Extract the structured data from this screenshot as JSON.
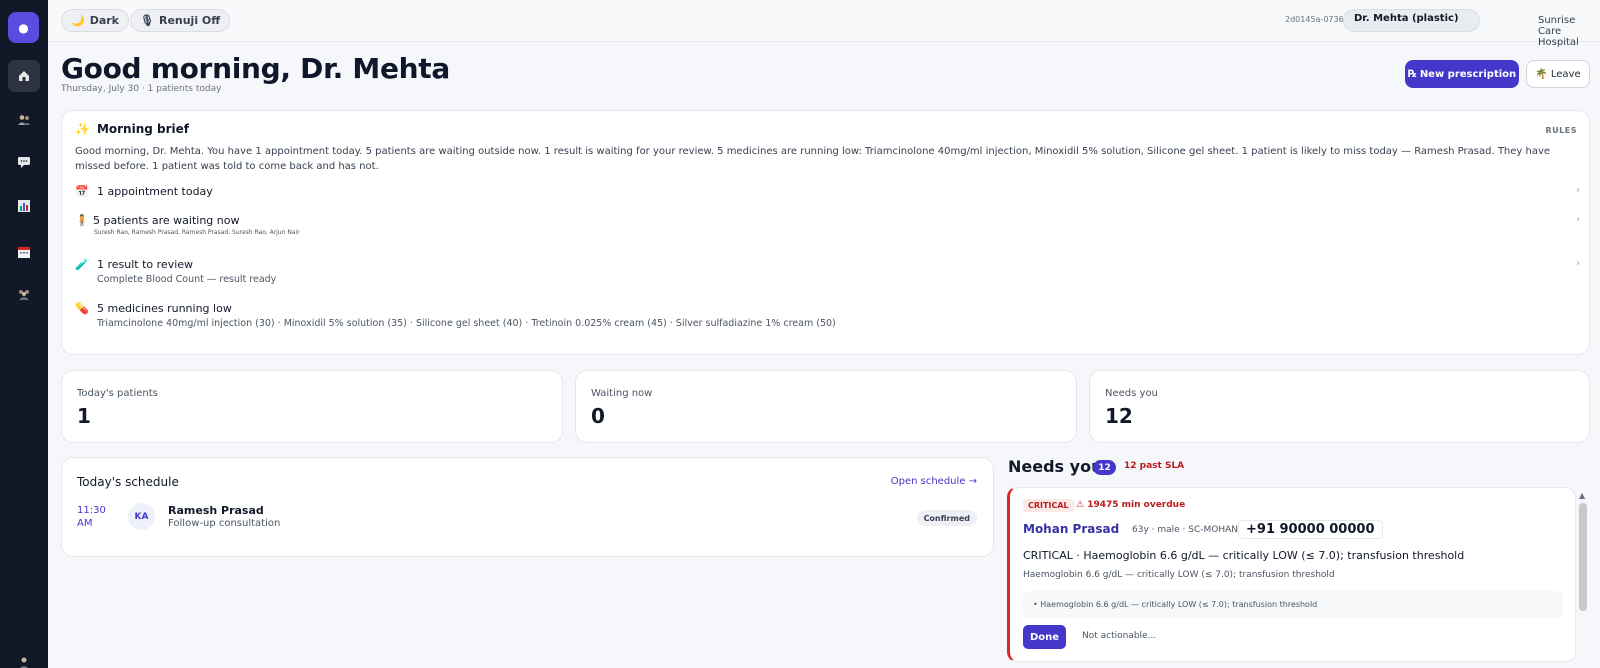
{
  "topbar": {
    "dark_label": "Dark",
    "renuji_label": "Renuji Off",
    "session_id": "2d0145a-0736",
    "user": "Dr. Mehta (plastic)",
    "hospital": "Sunrise Care Hospital"
  },
  "header": {
    "greeting": "Good morning, Dr. Mehta",
    "subdate": "Thursday, July 30 · 1 patients today",
    "new_rx_label": "New prescription",
    "leave_label": "Leave"
  },
  "brief": {
    "title": "Morning brief",
    "rules_label": "RULES",
    "text": "Good morning, Dr. Mehta.  You have 1 appointment today. 5 patients are waiting outside now. 1 result is waiting for your review. 5 medicines are running low: Triamcinolone 40mg/ml injection, Minoxidil 5% solution, Silicone gel sheet. 1 patient is likely to miss today — Ramesh Prasad. They have missed before. 1 patient was told to come back and has not.",
    "items": [
      {
        "label": "1 appointment today",
        "detail": ""
      },
      {
        "label": "5 patients are waiting now",
        "detail": "Suresh Rao, Ramesh Prasad, Ramesh Prasad, Suresh Rao, Arjun Nair"
      },
      {
        "label": "1 result to review",
        "detail": "Complete Blood Count — result ready"
      },
      {
        "label": "5 medicines running low",
        "detail": "Triamcinolone 40mg/ml injection (30) · Minoxidil 5% solution (35) · Silicone gel sheet (40) · Tretinoin 0.025% cream (45) · Silver sulfadiazine 1% cream (50)"
      }
    ]
  },
  "stats": [
    {
      "label": "Today's patients",
      "value": "1"
    },
    {
      "label": "Waiting now",
      "value": "0"
    },
    {
      "label": "Needs you",
      "value": "12"
    }
  ],
  "schedule": {
    "title": "Today's schedule",
    "open_label": "Open schedule →",
    "appointments": [
      {
        "time": "11:30 AM",
        "initials": "KA",
        "name": "Ramesh Prasad",
        "type": "Follow-up consultation",
        "status": "Confirmed"
      }
    ]
  },
  "needs": {
    "title": "Needs you",
    "count": "12",
    "sla": "12 past SLA",
    "alert": {
      "severity": "CRITICAL",
      "overdue": "⚠ 19475 min overdue",
      "patient": "Mohan Prasad",
      "meta": "63y · male · SC-MOHAN",
      "phone": "+91 90000 00000",
      "title": "CRITICAL · Haemoglobin 6.6 g/dL — critically LOW (≤ 7.0); transfusion threshold",
      "subtitle": "Haemoglobin 6.6 g/dL — critically LOW (≤ 7.0); transfusion threshold",
      "detail": "• Haemoglobin 6.6 g/dL — critically LOW (≤ 7.0); transfusion threshold",
      "done_label": "Done",
      "not_actionable_label": "Not actionable..."
    }
  },
  "icons": {
    "nav": [
      "home-icon",
      "patients-icon",
      "chat-icon",
      "chart-icon",
      "calendar-icon",
      "team-icon",
      "profile-icon"
    ]
  },
  "colors": {
    "accent": "#4338ca",
    "sidebar": "#111827",
    "critical": "#dc2626"
  }
}
